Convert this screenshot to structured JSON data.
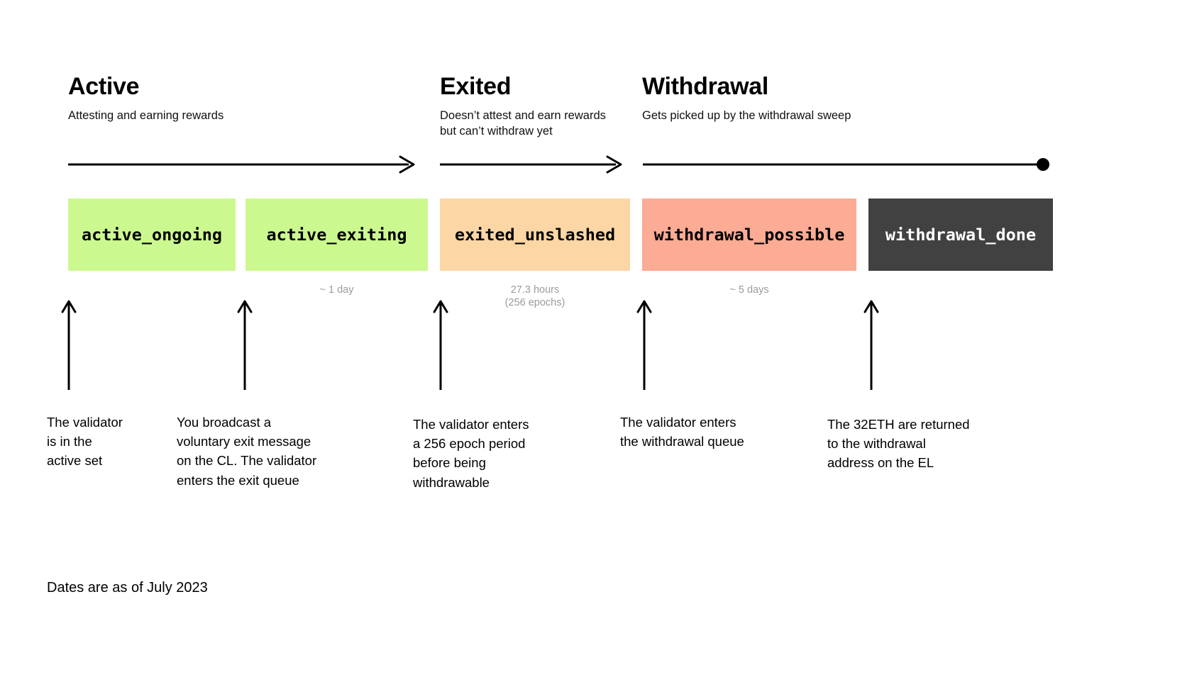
{
  "phases": [
    {
      "title": "Active",
      "subtitle": "Attesting and earning rewards"
    },
    {
      "title": "Exited",
      "subtitle": "Doesn’t attest and earn rewards\nbut can’t withdraw yet"
    },
    {
      "title": "Withdrawal",
      "subtitle": "Gets picked up by the withdrawal sweep"
    }
  ],
  "statuses": [
    {
      "label": "active_ongoing",
      "bg": "#ccf98f",
      "fg": "#000000"
    },
    {
      "label": "active_exiting",
      "bg": "#ccf98f",
      "fg": "#000000"
    },
    {
      "label": "exited_unslashed",
      "bg": "#fcd6a4",
      "fg": "#000000"
    },
    {
      "label": "withdrawal_possible",
      "bg": "#fcab94",
      "fg": "#000000"
    },
    {
      "label": "withdrawal_done",
      "bg": "#414141",
      "fg": "#ffffff"
    }
  ],
  "durations": [
    {
      "text": "~ 1 day"
    },
    {
      "text": "27.3 hours\n(256 epochs)"
    },
    {
      "text": "~ 5 days"
    }
  ],
  "notes": [
    {
      "text": "The validator\nis in the\nactive set"
    },
    {
      "text": "You broadcast a\nvoluntary exit message\non the CL. The validator\nenters the exit queue"
    },
    {
      "text": "The validator enters\na 256 epoch period\nbefore being\nwithdrawable"
    },
    {
      "text": "The validator enters\nthe withdrawal queue"
    },
    {
      "text": "The 32ETH are returned\nto the withdrawal\naddress on the EL"
    }
  ],
  "footer": {
    "text": "Dates are as of July 2023"
  },
  "colors": {
    "line": "#000000",
    "muted_text": "#9b9b9b",
    "background": "#ffffff"
  }
}
